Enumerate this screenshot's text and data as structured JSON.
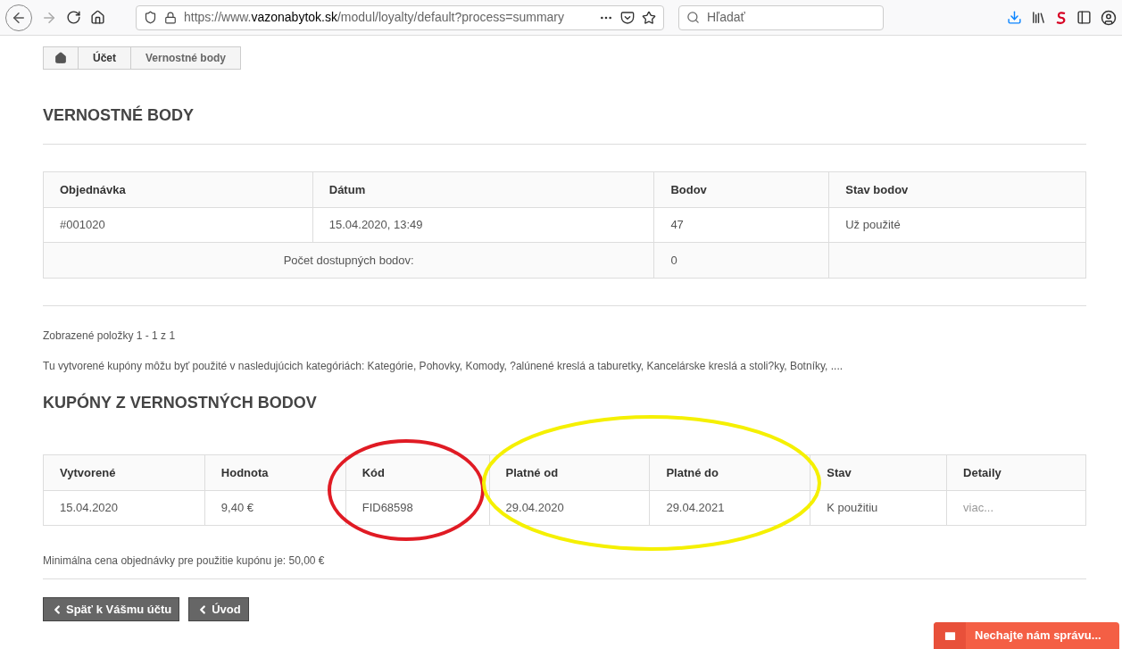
{
  "browser": {
    "url_prefix": "https://www.",
    "url_domain": "vazonabytok.sk",
    "url_path": "/modul/loyalty/default?process=summary",
    "search_placeholder": "Hľadať"
  },
  "breadcrumb": [
    "Účet",
    "Vernostné body"
  ],
  "points_section": {
    "title": "VERNOSTNÉ BODY",
    "columns": [
      "Objednávka",
      "Dátum",
      "Bodov",
      "Stav bodov"
    ],
    "rows": [
      [
        "#001020",
        "15.04.2020, 13:49",
        "47",
        "Už použité"
      ]
    ],
    "total_label": "Počet dostupných bodov:",
    "total_value": "0"
  },
  "pagination_info": "Zobrazené položky 1 - 1 z 1",
  "categories_note": "Tu vytvorené kupóny môžu byť použité v nasledujúcich kategóriách: Kategórie, Pohovky, Komody, ?alúnené kreslá a taburetky, Kancelárske kreslá a stoli?ky, Botníky, ....",
  "coupons_section": {
    "title": "KUPÓNY Z VERNOSTNÝCH BODOV",
    "columns": [
      "Vytvorené",
      "Hodnota",
      "Kód",
      "Platné od",
      "Platné do",
      "Stav",
      "Detaily"
    ],
    "rows": [
      [
        "15.04.2020",
        "9,40 €",
        "FID68598",
        "29.04.2020",
        "29.04.2021",
        "K použitiu",
        "viac..."
      ]
    ]
  },
  "min_order_note": "Minimálna cena objednávky pre použitie kupónu je: 50,00 €",
  "buttons": [
    "Späť k Vášmu účtu",
    "Úvod"
  ],
  "chat_button": "Nechajte nám správu..."
}
